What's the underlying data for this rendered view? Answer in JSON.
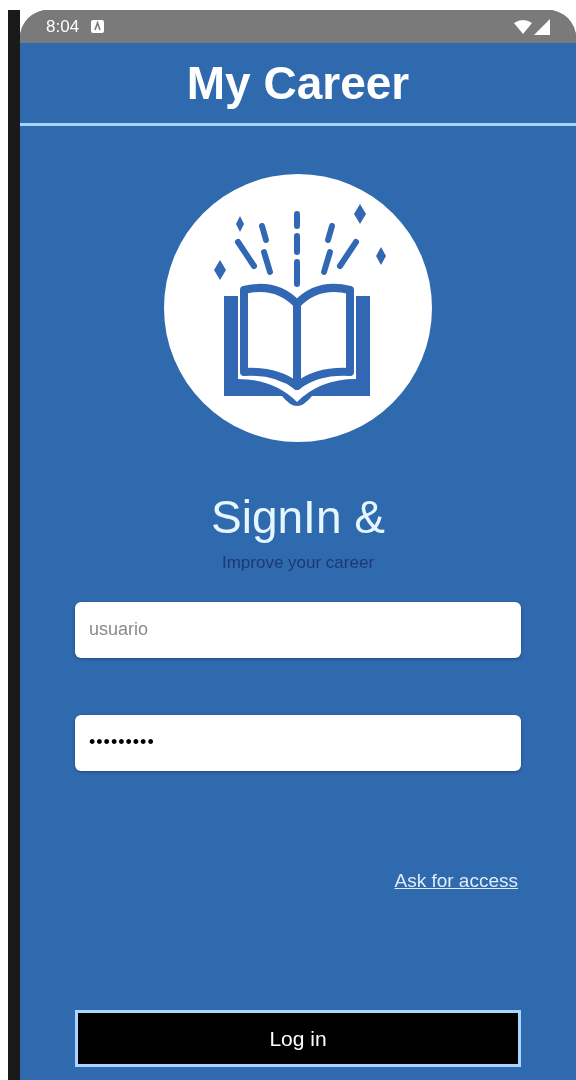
{
  "status_bar": {
    "time": "8:04"
  },
  "app_bar": {
    "title": "My Career"
  },
  "heading": "SignIn &",
  "subtitle": "Improve your career",
  "fields": [
    {
      "kind": "text",
      "placeholder": "usuario"
    },
    {
      "kind": "password",
      "value": "•••••••••"
    }
  ],
  "link": "Ask for access",
  "button": "Log in"
}
